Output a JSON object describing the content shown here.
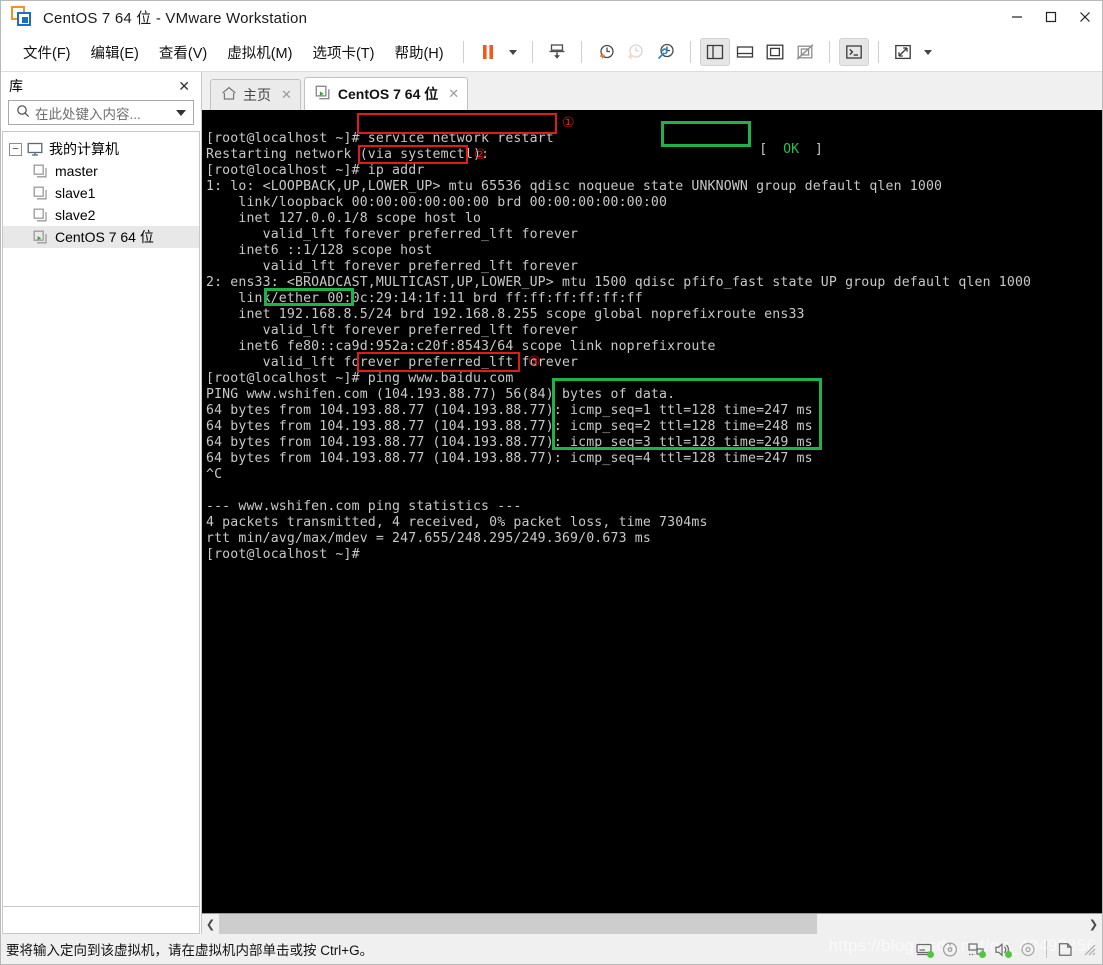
{
  "window": {
    "title": "CentOS 7 64 位 - VMware Workstation",
    "app_icon": "vmware-logo-icon",
    "minimize_label": "—",
    "maximize_label": "☐",
    "close_label": "✕"
  },
  "menubar": {
    "items": [
      {
        "name": "file",
        "text": "文件(F)",
        "accel": "F"
      },
      {
        "name": "edit",
        "text": "编辑(E)",
        "accel": "E"
      },
      {
        "name": "view",
        "text": "查看(V)",
        "accel": "V"
      },
      {
        "name": "vm",
        "text": "虚拟机(M)",
        "accel": "M"
      },
      {
        "name": "tabs",
        "text": "选项卡(T)",
        "accel": "T"
      },
      {
        "name": "help",
        "text": "帮助(H)",
        "accel": "H"
      }
    ]
  },
  "toolbar": {
    "buttons": [
      {
        "name": "suspend-icon",
        "title": "挂起"
      },
      {
        "name": "power-dropdown-caret-icon",
        "title": "电源选项"
      },
      {
        "name": "send-ctrl-alt-del-icon",
        "title": "发送 Ctrl+Alt+Del"
      },
      {
        "name": "take-snapshot-icon",
        "title": "拍摄快照"
      },
      {
        "name": "revert-snapshot-icon",
        "title": "恢复快照"
      },
      {
        "name": "snapshot-manager-icon",
        "title": "快照管理器"
      },
      {
        "name": "show-library-icon",
        "title": "显示或隐藏库"
      },
      {
        "name": "show-console-view-icon",
        "title": "控制台视图"
      },
      {
        "name": "full-screen-icon",
        "title": "全屏"
      },
      {
        "name": "unity-mode-icon",
        "title": "Unity 模式"
      },
      {
        "name": "show-thumbnail-bar-icon",
        "title": "显示缩略图栏"
      },
      {
        "name": "stretch-guest-icon",
        "title": "拉伸客户机"
      },
      {
        "name": "stretch-dropdown-caret-icon",
        "title": "拉伸选项"
      }
    ]
  },
  "library": {
    "title": "库",
    "close_label": "✕",
    "search": {
      "placeholder": "在此处键入内容...",
      "value": "",
      "icon": "search-icon",
      "dropdown_icon": "chevron-down-icon"
    },
    "tree": [
      {
        "name": "my-computer",
        "label": "我的计算机",
        "icon": "monitor-icon",
        "level": 0,
        "expander": "−",
        "selected": false
      },
      {
        "name": "master",
        "label": "master",
        "icon": "vm-icon",
        "level": 1,
        "selected": false
      },
      {
        "name": "slave1",
        "label": "slave1",
        "icon": "vm-icon",
        "level": 1,
        "selected": false
      },
      {
        "name": "slave2",
        "label": "slave2",
        "icon": "vm-icon",
        "level": 1,
        "selected": false
      },
      {
        "name": "centos7",
        "label": "CentOS 7 64 位",
        "icon": "vm-running-icon",
        "level": 1,
        "selected": true
      }
    ]
  },
  "tabs": [
    {
      "name": "home",
      "label": "主页",
      "icon": "home-icon",
      "active": false,
      "close_label": "✕"
    },
    {
      "name": "centos7",
      "label": "CentOS 7 64 位",
      "icon": "vm-running-icon",
      "active": true,
      "close_label": "✕"
    }
  ],
  "terminal": {
    "background": "#000000",
    "foreground": "#c8c8c8",
    "ok_color": "#24c04f",
    "lines": [
      "[root@localhost ~]# service network restart",
      "Restarting network (via systemctl):",
      "[root@localhost ~]# ip addr",
      "1: lo: <LOOPBACK,UP,LOWER_UP> mtu 65536 qdisc noqueue state UNKNOWN group default qlen 1000",
      "    link/loopback 00:00:00:00:00:00 brd 00:00:00:00:00:00",
      "    inet 127.0.0.1/8 scope host lo",
      "       valid_lft forever preferred_lft forever",
      "    inet6 ::1/128 scope host",
      "       valid_lft forever preferred_lft forever",
      "2: ens33: <BROADCAST,MULTICAST,UP,LOWER_UP> mtu 1500 qdisc pfifo_fast state UP group default qlen 1000",
      "    link/ether 00:0c:29:14:1f:11 brd ff:ff:ff:ff:ff:ff",
      "    inet 192.168.8.5/24 brd 192.168.8.255 scope global noprefixroute ens33",
      "       valid_lft forever preferred_lft forever",
      "    inet6 fe80::ca9d:952a:c20f:8543/64 scope link noprefixroute",
      "       valid_lft forever preferred_lft forever",
      "[root@localhost ~]# ping www.baidu.com",
      "PING www.wshifen.com (104.193.88.77) 56(84) bytes of data.",
      "64 bytes from 104.193.88.77 (104.193.88.77): icmp_seq=1 ttl=128 time=247 ms",
      "64 bytes from 104.193.88.77 (104.193.88.77): icmp_seq=2 ttl=128 time=248 ms",
      "64 bytes from 104.193.88.77 (104.193.88.77): icmp_seq=3 ttl=128 time=249 ms",
      "64 bytes from 104.193.88.77 (104.193.88.77): icmp_seq=4 ttl=128 time=247 ms",
      "^C",
      "",
      "--- www.wshifen.com ping statistics ---",
      "4 packets transmitted, 4 received, 0% packet loss, time 7304ms",
      "rtt min/avg/max/mdev = 247.655/248.295/249.369/0.673 ms",
      "[root@localhost ~]#"
    ],
    "ok_badge": {
      "open_bracket": "[",
      "text": "OK",
      "close_bracket": "]"
    },
    "annotations": [
      {
        "name": "annotation-1",
        "marker": "①",
        "color": "#e01b1b",
        "target": "service network restart"
      },
      {
        "name": "annotation-2",
        "marker": "②",
        "color": "#e01b1b",
        "target": "ip addr"
      },
      {
        "name": "annotation-3",
        "marker": "③",
        "color": "#e01b1b",
        "target": "ping www.baidu.com"
      },
      {
        "name": "annotation-ok",
        "marker": "",
        "color": "#1fb14b",
        "target": "[  OK  ]"
      },
      {
        "name": "annotation-ip",
        "marker": "",
        "color": "#1fb14b",
        "target": "192.168.8.5"
      },
      {
        "name": "annotation-ping-replies",
        "marker": "",
        "color": "#1fb14b",
        "target": "icmp replies"
      }
    ]
  },
  "scrollbar": {
    "left_arrow": "❮",
    "right_arrow": "❯",
    "thumb_percent": 69
  },
  "statusbar": {
    "message": "要将输入定向到该虚拟机，请在虚拟机内部单击或按 Ctrl+G。",
    "watermark": "https://blog.csdn.net/qq_43492356",
    "devices": [
      {
        "name": "hard-disk-device-icon",
        "connected": true
      },
      {
        "name": "cd-dvd-device-icon",
        "connected": false
      },
      {
        "name": "network-adapter-device-icon",
        "connected": true
      },
      {
        "name": "sound-card-device-icon",
        "connected": true
      },
      {
        "name": "printer-device-icon",
        "connected": false
      },
      {
        "name": "usb-device-icon",
        "connected": false
      }
    ],
    "resize_grip": "resize-grip-icon"
  }
}
